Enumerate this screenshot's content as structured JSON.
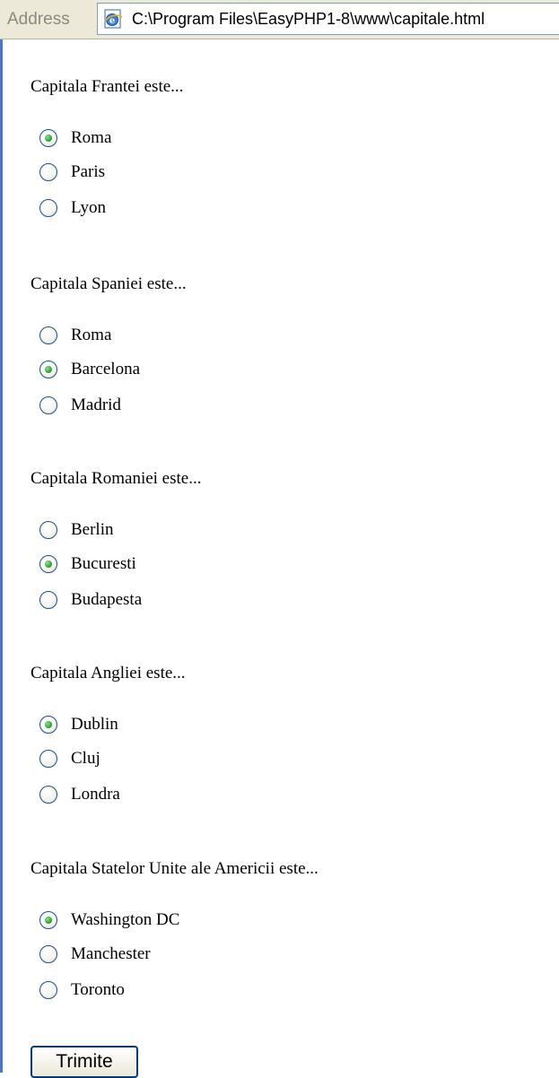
{
  "address_bar": {
    "label": "Address",
    "url": "C:\\Program Files\\EasyPHP1-8\\www\\capitale.html",
    "icon": "ie-page-icon"
  },
  "quiz": {
    "questions": [
      {
        "text": "Capitala Frantei este...",
        "options": [
          {
            "label": "Roma",
            "checked": true
          },
          {
            "label": "Paris",
            "checked": false
          },
          {
            "label": "Lyon",
            "checked": false
          }
        ]
      },
      {
        "text": "Capitala Spaniei este...",
        "options": [
          {
            "label": "Roma",
            "checked": false
          },
          {
            "label": "Barcelona",
            "checked": true
          },
          {
            "label": "Madrid",
            "checked": false
          }
        ]
      },
      {
        "text": "Capitala Romaniei este...",
        "options": [
          {
            "label": "Berlin",
            "checked": false
          },
          {
            "label": "Bucuresti",
            "checked": true
          },
          {
            "label": "Budapesta",
            "checked": false
          }
        ]
      },
      {
        "text": "Capitala Angliei este...",
        "options": [
          {
            "label": "Dublin",
            "checked": true
          },
          {
            "label": "Cluj",
            "checked": false
          },
          {
            "label": "Londra",
            "checked": false
          }
        ]
      },
      {
        "text": "Capitala Statelor Unite ale Americii este...",
        "options": [
          {
            "label": "Washington DC",
            "checked": true
          },
          {
            "label": "Manchester",
            "checked": false
          },
          {
            "label": "Toronto",
            "checked": false
          }
        ]
      }
    ],
    "submit_label": "Trimite"
  }
}
